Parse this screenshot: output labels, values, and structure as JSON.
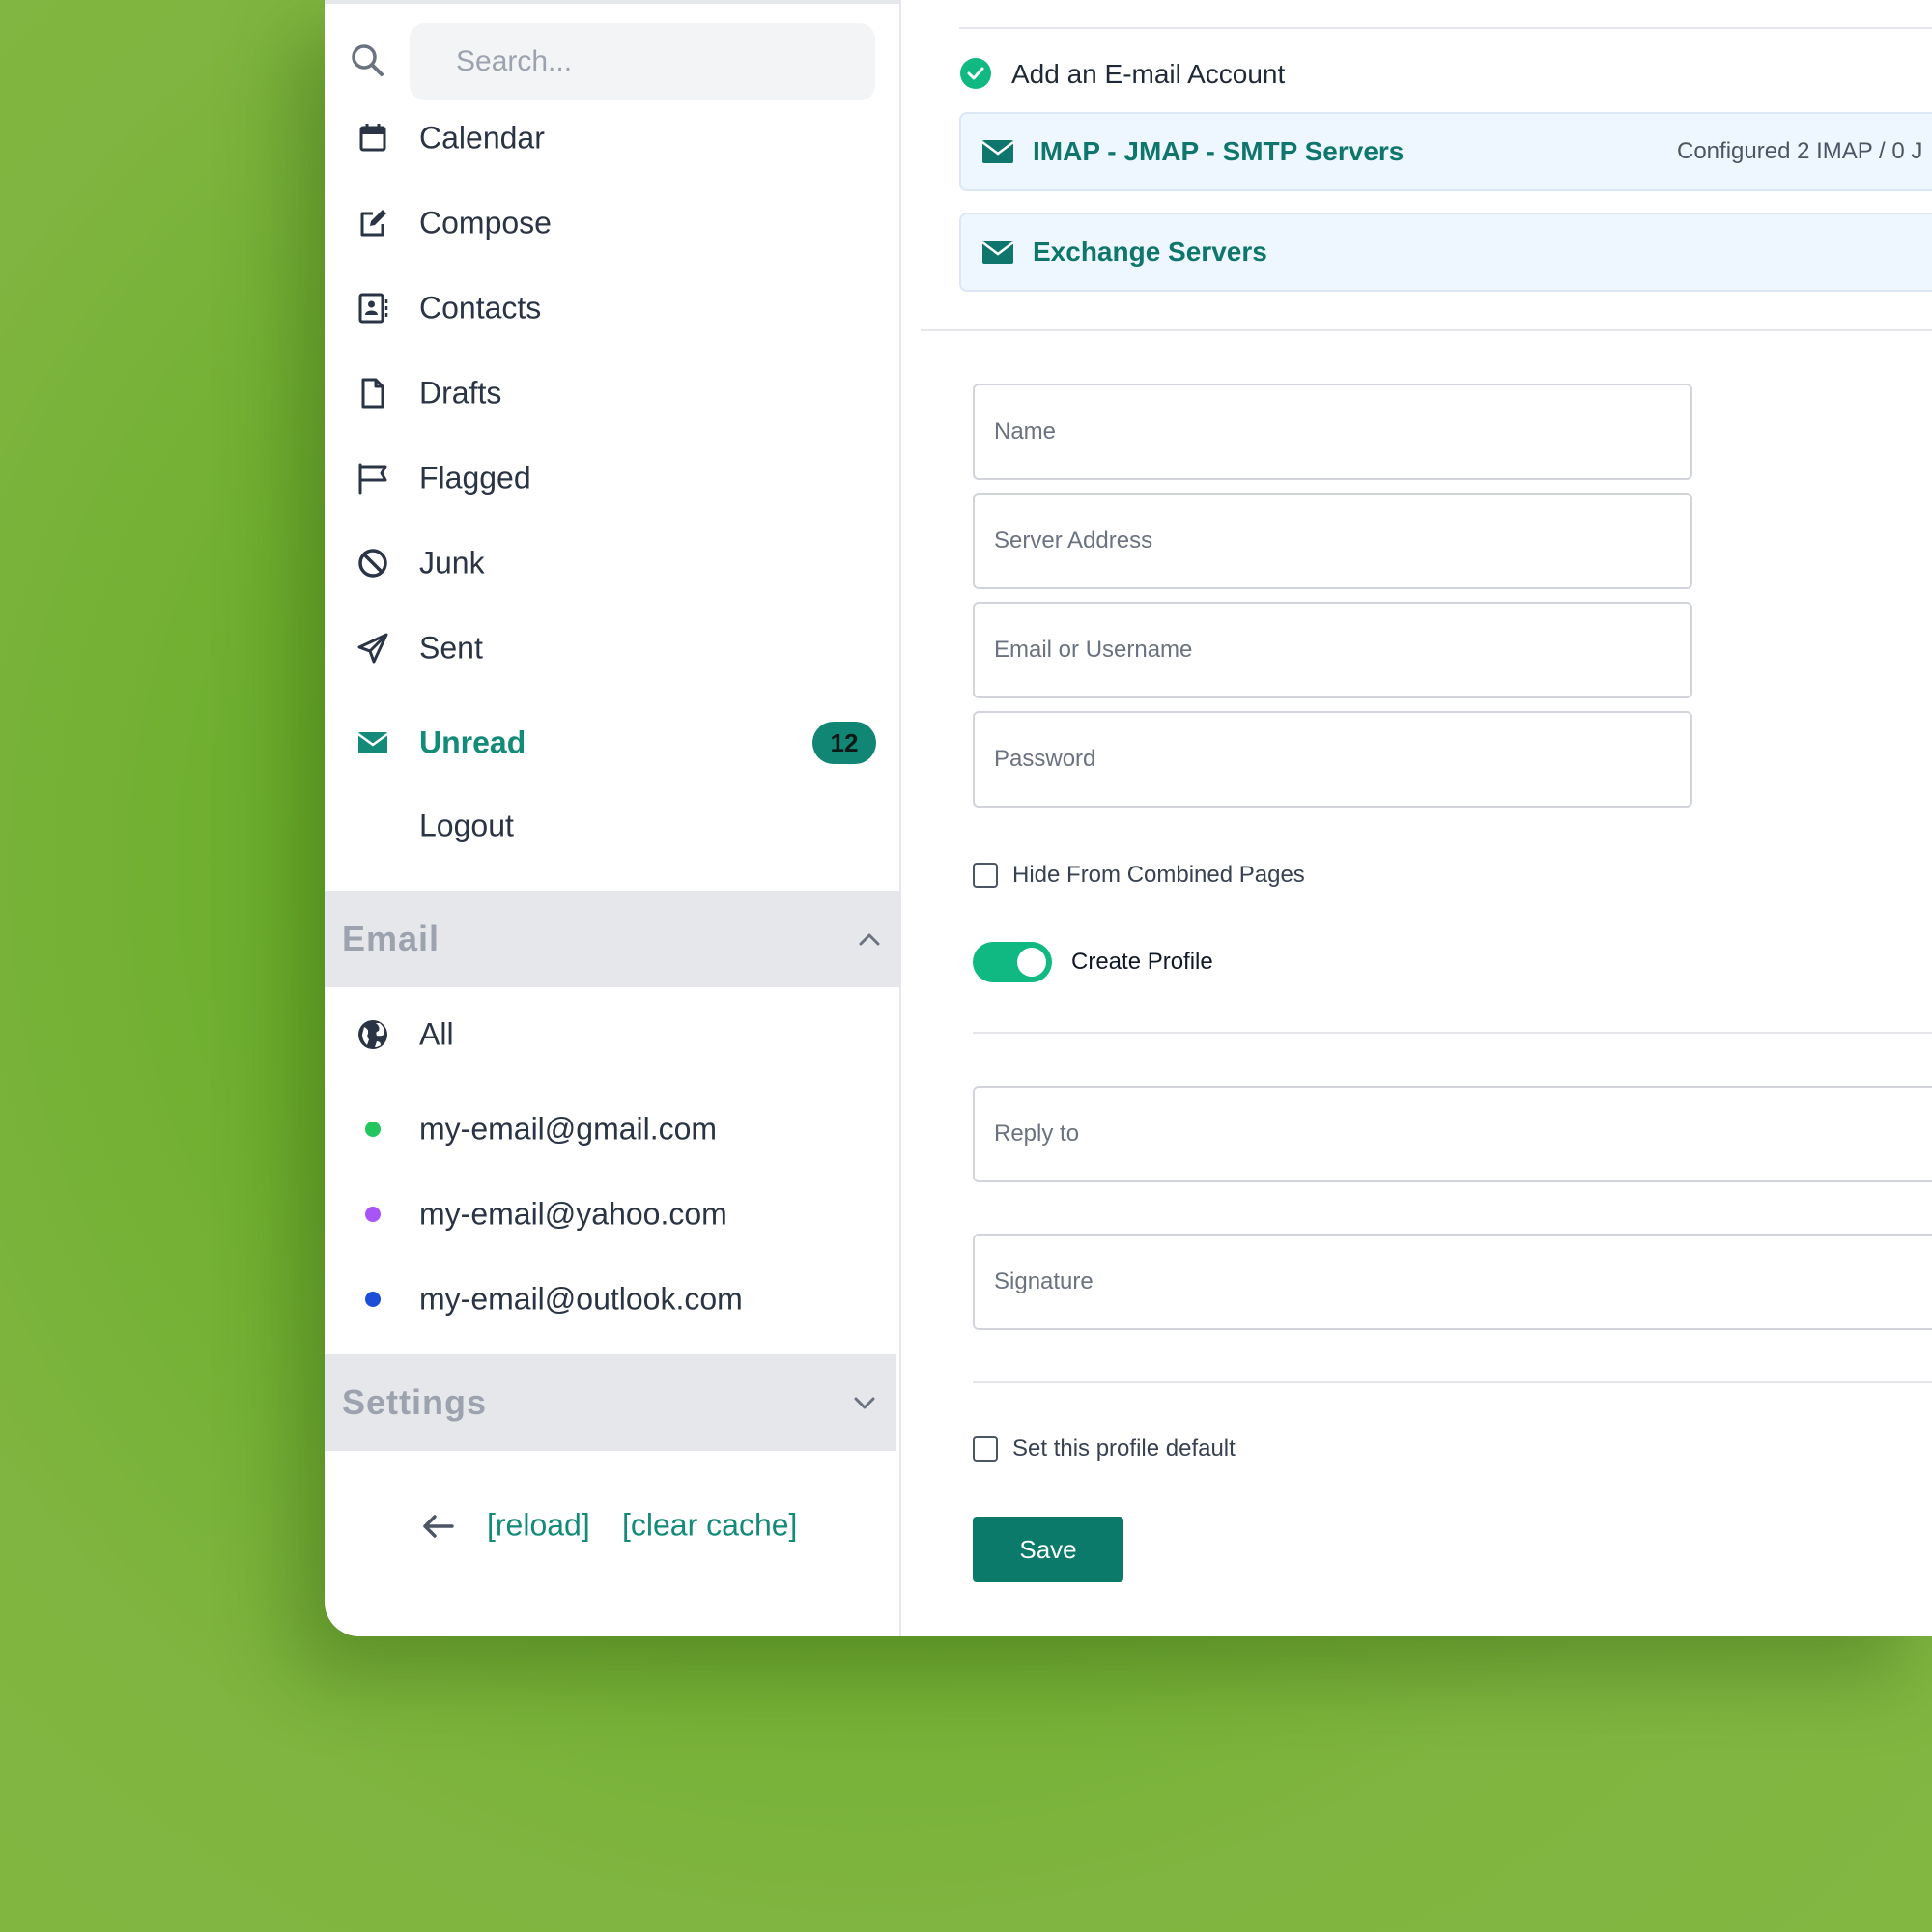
{
  "search": {
    "placeholder": "Search..."
  },
  "nav": {
    "calendar": "Calendar",
    "compose": "Compose",
    "contacts": "Contacts",
    "drafts": "Drafts",
    "flagged": "Flagged",
    "junk": "Junk",
    "sent": "Sent",
    "unread": "Unread",
    "unread_count": "12",
    "logout": "Logout"
  },
  "email_section": {
    "title": "Email",
    "all": "All",
    "accounts": [
      {
        "address": "my-email@gmail.com",
        "color": "#22c55e"
      },
      {
        "address": "my-email@yahoo.com",
        "color": "#a855f7"
      },
      {
        "address": "my-email@outlook.com",
        "color": "#1d4ed8"
      }
    ]
  },
  "settings_section": {
    "title": "Settings"
  },
  "footer": {
    "reload": "[reload]",
    "clear_cache": "[clear cache]"
  },
  "main": {
    "add_account": "Add an E-mail Account",
    "imap_box": {
      "title": "IMAP - JMAP - SMTP Servers",
      "status": "Configured 2 IMAP / 0 J"
    },
    "exchange_box": {
      "title": "Exchange Servers"
    },
    "form": {
      "name_placeholder": "Name",
      "server_placeholder": "Server Address",
      "email_placeholder": "Email or Username",
      "password_placeholder": "Password",
      "hide_label": "Hide From Combined Pages",
      "create_profile_label": "Create Profile",
      "reply_placeholder": "Reply to",
      "signature_placeholder": "Signature",
      "default_label": "Set this profile default",
      "save_label": "Save"
    }
  },
  "colors": {
    "accent": "#148a78",
    "background": "#7fb540",
    "toggle_on": "#10b981",
    "save_button": "#0b7a6a"
  }
}
